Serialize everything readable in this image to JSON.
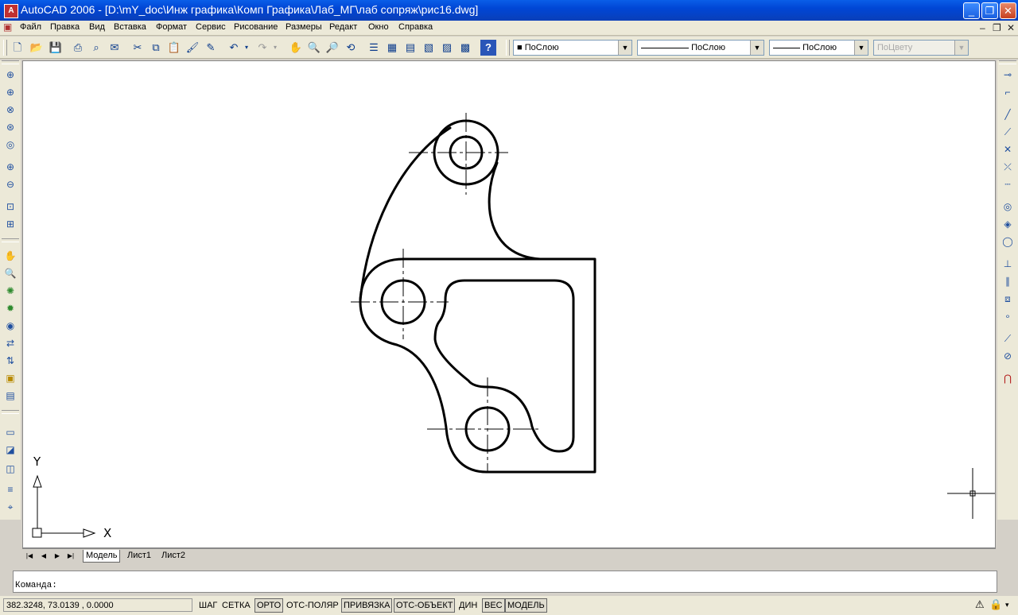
{
  "window": {
    "title": "AutoCAD 2006 - [D:\\mY_doc\\Инж графика\\Комп Графика\\Лаб_МГ\\лаб сопряж\\рис16.dwg]"
  },
  "menu": [
    "Файл",
    "Правка",
    "Вид",
    "Вставка",
    "Формат",
    "Сервис",
    "Рисование",
    "Размеры",
    "Редакт",
    "Окно",
    "Справка"
  ],
  "properties": {
    "color": "ПоСлою",
    "linetype": "ПоСлою",
    "lineweight": "ПоСлою",
    "plotstyle": "ПоЦвету"
  },
  "ucs": {
    "x_label": "X",
    "y_label": "Y"
  },
  "tabs": [
    "Модель",
    "Лист1",
    "Лист2"
  ],
  "command": {
    "prompt": "Команда:"
  },
  "status": {
    "coords": "382.3248, 73.0139 , 0.0000",
    "buttons": [
      "ШАГ",
      "СЕТКА",
      "ОРТО",
      "ОТС-ПОЛЯР",
      "ПРИВЯЗКА",
      "ОТС-ОБЪЕКТ",
      "ДИН",
      "ВЕС",
      "МОДЕЛЬ"
    ],
    "active": [
      "ОРТО",
      "ПРИВЯЗКА",
      "ОТС-ОБЪЕКТ",
      "ВЕС",
      "МОДЕЛЬ"
    ]
  },
  "colors": {
    "titlebar": "#0046d5",
    "canvas": "#ffffff",
    "chrome": "#ece9d8"
  }
}
